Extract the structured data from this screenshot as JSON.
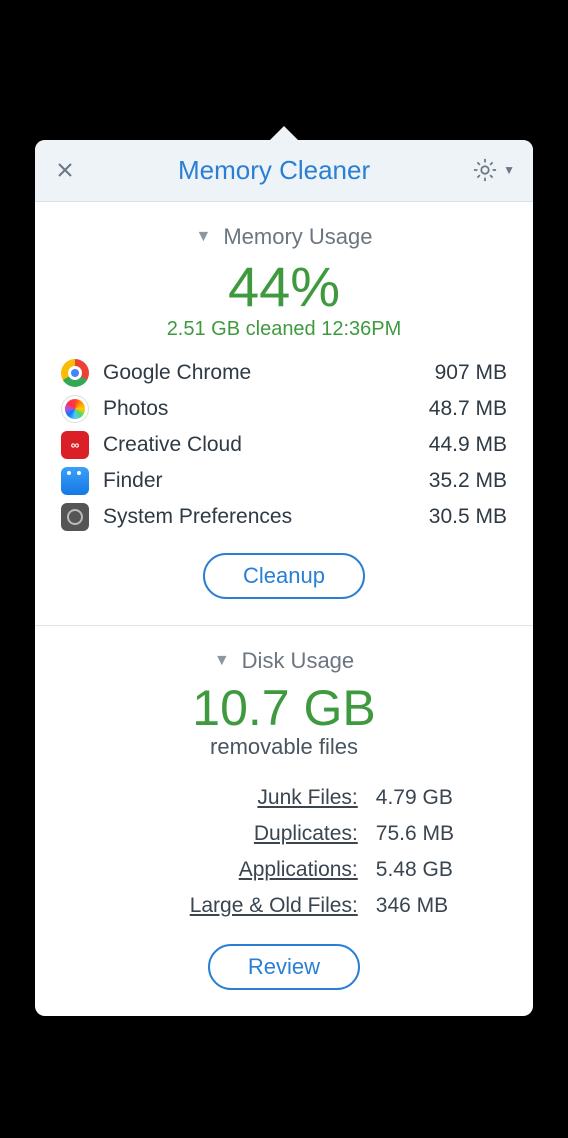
{
  "header": {
    "title": "Memory Cleaner"
  },
  "memory": {
    "section_title": "Memory Usage",
    "percent": "44%",
    "cleaned_line": "2.51 GB cleaned 12:36PM",
    "apps": [
      {
        "name": "Google Chrome",
        "size": "907 MB",
        "icon": "chrome-icon"
      },
      {
        "name": "Photos",
        "size": "48.7 MB",
        "icon": "photos-icon"
      },
      {
        "name": "Creative Cloud",
        "size": "44.9 MB",
        "icon": "creative-cloud-icon"
      },
      {
        "name": "Finder",
        "size": "35.2 MB",
        "icon": "finder-icon"
      },
      {
        "name": "System Preferences",
        "size": "30.5 MB",
        "icon": "system-preferences-icon"
      }
    ],
    "cleanup_label": "Cleanup"
  },
  "disk": {
    "section_title": "Disk Usage",
    "big_value": "10.7 GB",
    "subtitle": "removable files",
    "rows": [
      {
        "label": "Junk Files:",
        "value": "4.79 GB"
      },
      {
        "label": "Duplicates:",
        "value": "75.6 MB"
      },
      {
        "label": "Applications:",
        "value": "5.48 GB"
      },
      {
        "label": "Large & Old Files:",
        "value": "346 MB"
      }
    ],
    "review_label": "Review"
  }
}
